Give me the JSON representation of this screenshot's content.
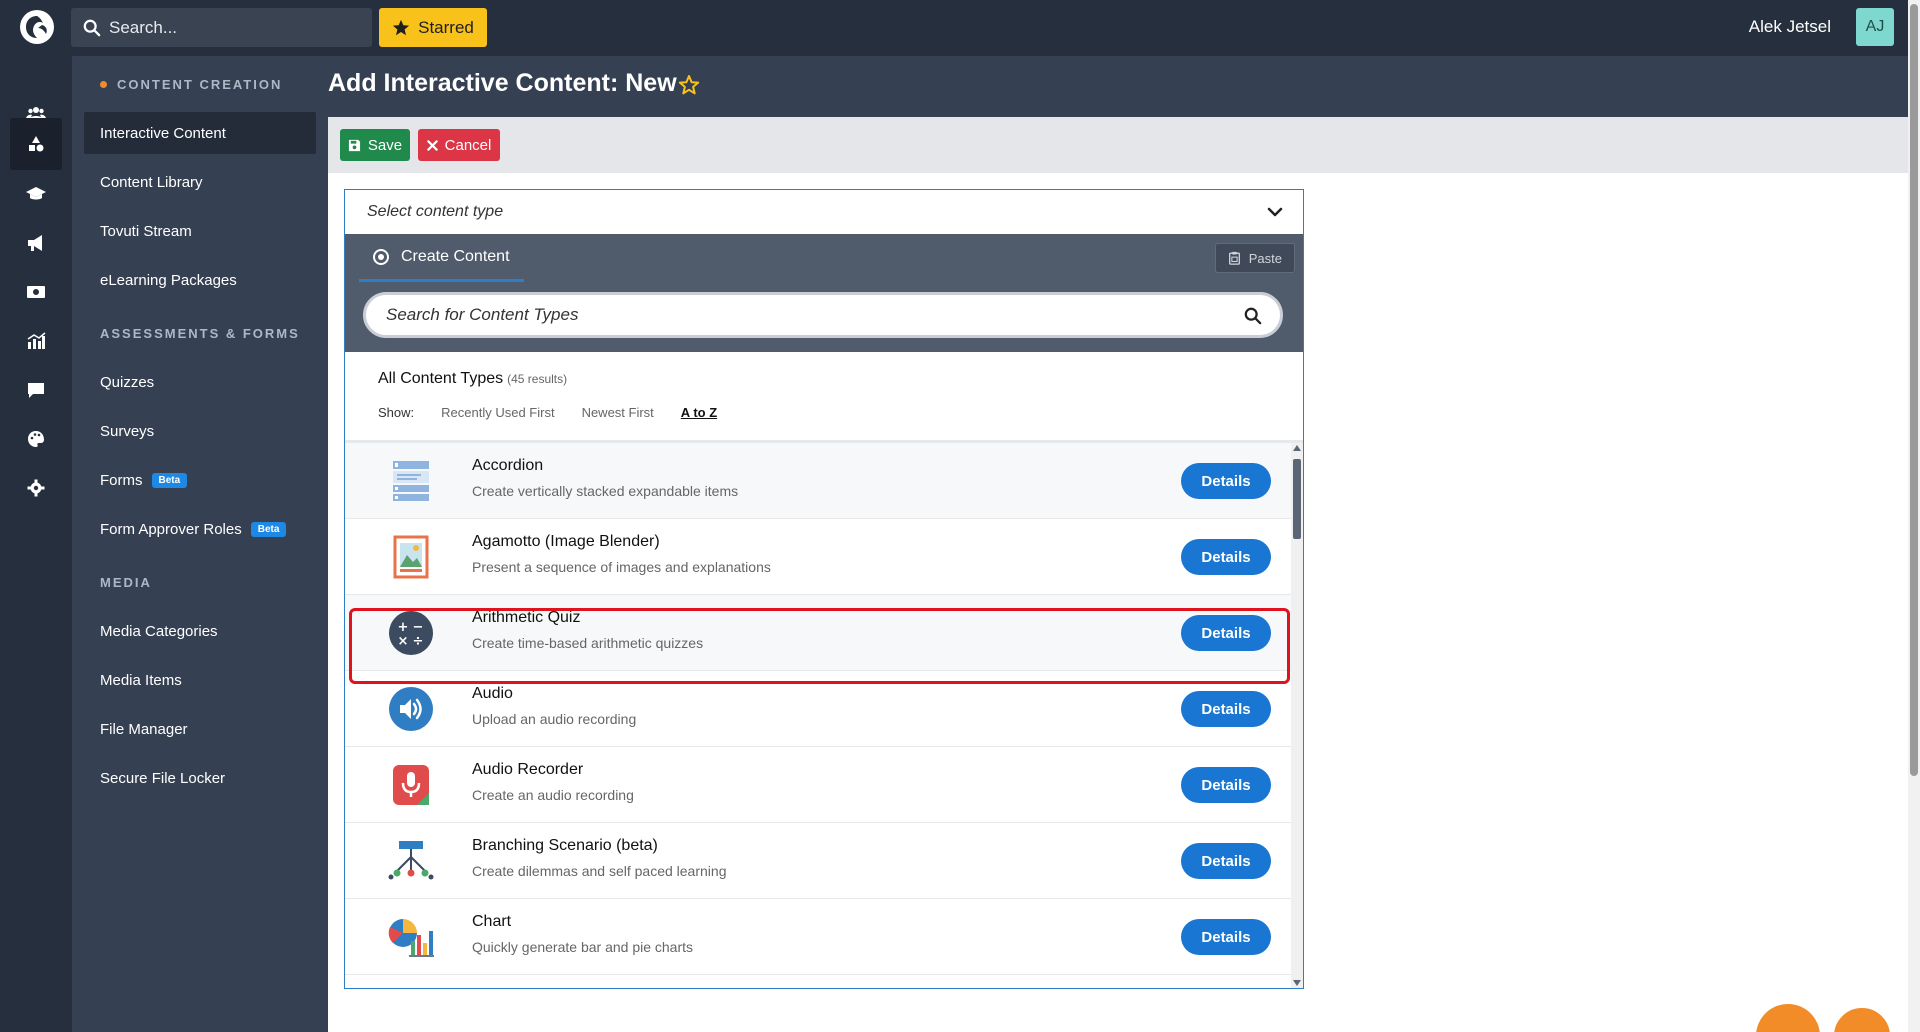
{
  "topbar": {
    "search_placeholder": "Search...",
    "starred_label": "Starred",
    "user_name": "Alek Jetsel",
    "avatar_initials": "AJ"
  },
  "rail": {
    "icons": [
      "users-icon",
      "content-creation-icon",
      "graduation-cap-icon",
      "megaphone-icon",
      "media-icon",
      "analytics-icon",
      "chat-icon",
      "palette-icon",
      "settings-icon"
    ]
  },
  "sidebar": {
    "content_creation_heading": "CONTENT CREATION",
    "content_creation_items": [
      "Interactive Content",
      "Content Library",
      "Tovuti Stream",
      "eLearning Packages"
    ],
    "assessments_heading": "ASSESSMENTS & FORMS",
    "assessment_items": [
      "Quizzes",
      "Surveys",
      "Forms",
      "Form Approver Roles"
    ],
    "beta_label": "Beta",
    "media_heading": "MEDIA",
    "media_items": [
      "Media Categories",
      "Media Items",
      "File Manager",
      "Secure File Locker"
    ]
  },
  "page": {
    "title": "Add Interactive Content: New",
    "save_label": "Save",
    "cancel_label": "Cancel"
  },
  "panel": {
    "select_placeholder": "Select content type",
    "create_tab_label": "Create Content",
    "paste_label": "Paste",
    "search_placeholder": "Search for Content Types",
    "results_title": "All Content Types",
    "results_count": "(45 results)",
    "show_label": "Show:",
    "sort_options": [
      "Recently Used First",
      "Newest First",
      "A to Z"
    ],
    "selected_sort": "A to Z",
    "details_label": "Details",
    "items": [
      {
        "name": "Accordion",
        "desc": "Create vertically stacked expandable items",
        "icon": "accordion-icon"
      },
      {
        "name": "Agamotto (Image Blender)",
        "desc": "Present a sequence of images and explanations",
        "icon": "image-blender-icon"
      },
      {
        "name": "Arithmetic Quiz",
        "desc": "Create time-based arithmetic quizzes",
        "icon": "arithmetic-icon"
      },
      {
        "name": "Audio",
        "desc": "Upload an audio recording",
        "icon": "audio-icon"
      },
      {
        "name": "Audio Recorder",
        "desc": "Create an audio recording",
        "icon": "microphone-icon"
      },
      {
        "name": "Branching Scenario (beta)",
        "desc": "Create dilemmas and self paced learning",
        "icon": "branching-icon"
      },
      {
        "name": "Chart",
        "desc": "Quickly generate bar and pie charts",
        "icon": "chart-icon"
      }
    ]
  },
  "colors": {
    "topbar_bg": "#262f3d",
    "sidebar_bg": "#354052",
    "starred_yellow": "#f8c21a",
    "save_green": "#1f8a4c",
    "cancel_red": "#dc3545",
    "details_blue": "#1976d2",
    "highlight_red": "#e0121d",
    "accent_orange": "#f28c28"
  }
}
